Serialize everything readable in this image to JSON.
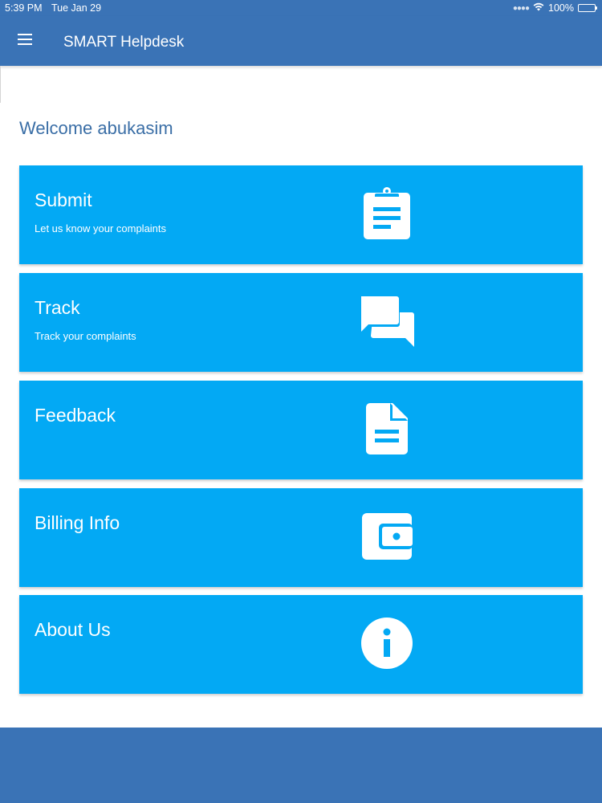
{
  "status_bar": {
    "time": "5:39 PM",
    "date": "Tue Jan 29",
    "battery": "100%"
  },
  "app_bar": {
    "title": "SMART Helpdesk",
    "color": "#3a73b6"
  },
  "welcome": "Welcome abukasim",
  "tiles": [
    {
      "title": "Submit",
      "subtitle": "Let us know your complaints",
      "icon": "clipboard-icon"
    },
    {
      "title": "Track",
      "subtitle": "Track your complaints",
      "icon": "chat-bubbles-icon"
    },
    {
      "title": "Feedback",
      "subtitle": "",
      "icon": "document-icon"
    },
    {
      "title": "Billing Info",
      "subtitle": "",
      "icon": "wallet-icon"
    },
    {
      "title": "About Us",
      "subtitle": "",
      "icon": "info-icon"
    }
  ],
  "colors": {
    "tile": "#03a9f4",
    "primary": "#3a73b6",
    "welcome_text": "#3a6ea6"
  }
}
